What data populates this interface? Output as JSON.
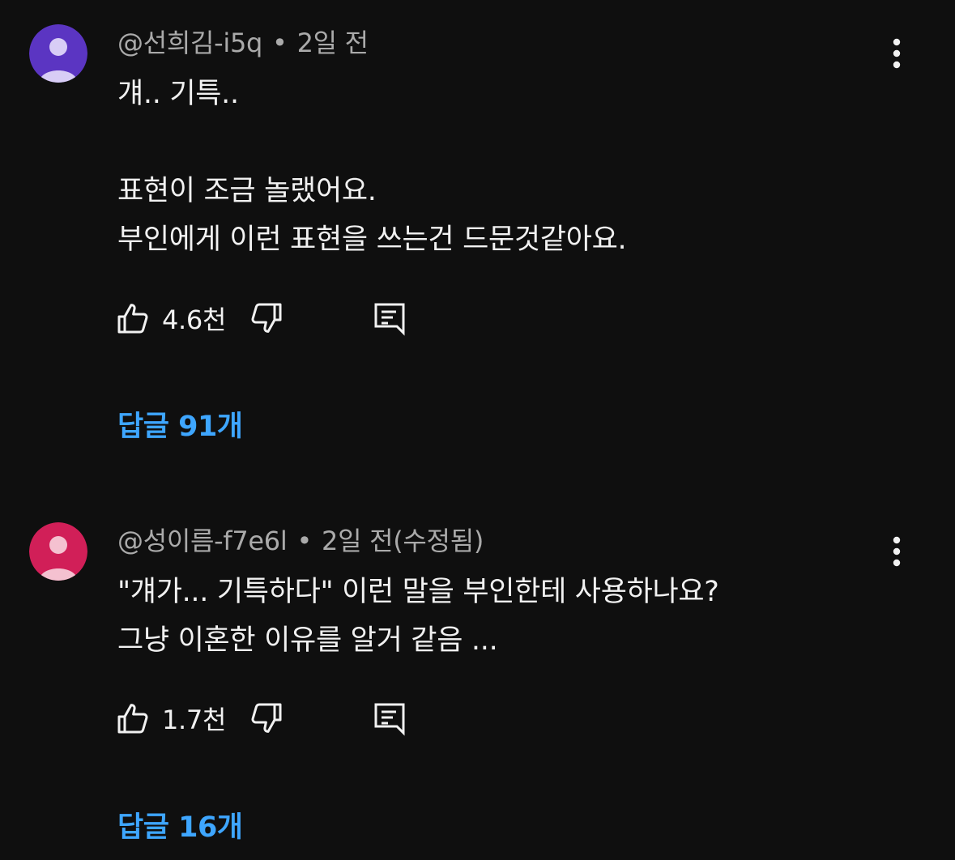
{
  "colors": {
    "background": "#0f0f0f",
    "text_primary": "#f1f1f1",
    "text_secondary": "#aaaaaa",
    "link_blue": "#3ea6ff",
    "avatar_1": "#5b35c2",
    "avatar_2": "#d11f58"
  },
  "comments": [
    {
      "author": "@선희김-i5q",
      "separator": "•",
      "time": "2일 전",
      "edited": "",
      "avatar_icon": "default-user-icon",
      "text_lines": [
        "걔.. 기특..",
        "",
        "표현이 조금 놀랬어요.",
        "부인에게 이런 표현을 쓰는건 드문것같아요."
      ],
      "likes": "4.6천",
      "replies_label": "답글 91개"
    },
    {
      "author": "@성이름-f7e6l",
      "separator": "•",
      "time": "2일 전",
      "edited": "(수정됨)",
      "avatar_icon": "default-user-icon",
      "text_lines": [
        "\"걔가... 기특하다\" 이런 말을 부인한테 사용하나요?",
        "그냥 이혼한 이유를 알거 같음 ..."
      ],
      "likes": "1.7천",
      "replies_label": "답글 16개"
    }
  ]
}
